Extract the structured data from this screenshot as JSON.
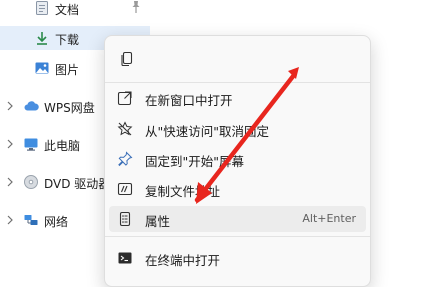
{
  "nav": {
    "items": [
      {
        "label": "文档",
        "icon": "documents-icon"
      },
      {
        "label": "下载",
        "icon": "download-icon"
      },
      {
        "label": "图片",
        "icon": "pictures-icon"
      },
      {
        "label": "WPS网盘",
        "icon": "cloud-icon"
      },
      {
        "label": "此电脑",
        "icon": "computer-icon"
      },
      {
        "label": "DVD 驱动器",
        "icon": "dvd-icon"
      },
      {
        "label": "网络",
        "icon": "network-icon"
      }
    ]
  },
  "menu": {
    "top_icon": "copy-icon",
    "items": [
      {
        "label": "在新窗口中打开",
        "icon": "open-new-window-icon"
      },
      {
        "label": "从\"快速访问\"取消固定",
        "icon": "unpin-star-icon"
      },
      {
        "label": "固定到\"开始\"屏幕",
        "icon": "pin-icon"
      },
      {
        "label": "复制文件地址",
        "icon": "copy-path-icon"
      },
      {
        "label": "属性",
        "icon": "properties-icon",
        "shortcut": "Alt+Enter"
      },
      {
        "label": "在终端中打开",
        "icon": "terminal-icon"
      }
    ]
  },
  "annotation": {
    "color": "#e8261e"
  }
}
